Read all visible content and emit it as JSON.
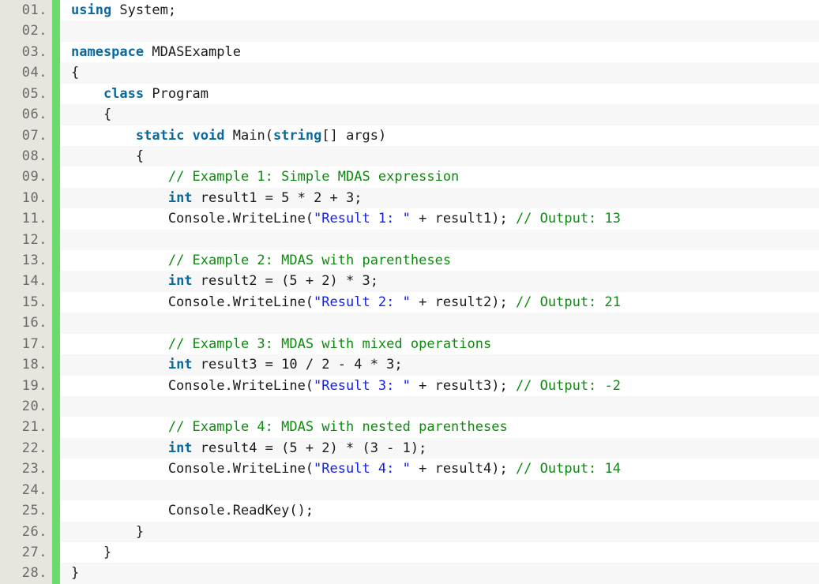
{
  "editor": {
    "language": "csharp",
    "total_lines": 28,
    "gutter_number_suffix": ".",
    "colors": {
      "gutter_background": "#e7e5dd",
      "gutter_text": "#6a6a6a",
      "marker_bar": "#6bdc6b",
      "row_odd_background": "#ffffff",
      "row_even_background": "#f7f7f7",
      "keyword": "#0b6a9d",
      "string": "#1420e8",
      "comment": "#0f8a10",
      "plain": "#1b1b1b"
    }
  },
  "lines": [
    {
      "number": "01.",
      "tokens": [
        {
          "t": "kw",
          "v": "using"
        },
        {
          "t": "pln",
          "v": " System;"
        }
      ]
    },
    {
      "number": "02.",
      "tokens": []
    },
    {
      "number": "03.",
      "tokens": [
        {
          "t": "kw",
          "v": "namespace"
        },
        {
          "t": "pln",
          "v": " MDASExample"
        }
      ]
    },
    {
      "number": "04.",
      "tokens": [
        {
          "t": "pln",
          "v": "{"
        }
      ]
    },
    {
      "number": "05.",
      "tokens": [
        {
          "t": "pln",
          "v": "    "
        },
        {
          "t": "kw",
          "v": "class"
        },
        {
          "t": "pln",
          "v": " Program"
        }
      ]
    },
    {
      "number": "06.",
      "tokens": [
        {
          "t": "pln",
          "v": "    {"
        }
      ]
    },
    {
      "number": "07.",
      "tokens": [
        {
          "t": "pln",
          "v": "        "
        },
        {
          "t": "kw",
          "v": "static"
        },
        {
          "t": "pln",
          "v": " "
        },
        {
          "t": "kw",
          "v": "void"
        },
        {
          "t": "pln",
          "v": " Main("
        },
        {
          "t": "kw",
          "v": "string"
        },
        {
          "t": "pln",
          "v": "[] args)"
        }
      ]
    },
    {
      "number": "08.",
      "tokens": [
        {
          "t": "pln",
          "v": "        {"
        }
      ]
    },
    {
      "number": "09.",
      "tokens": [
        {
          "t": "pln",
          "v": "            "
        },
        {
          "t": "com",
          "v": "// Example 1: Simple MDAS expression"
        }
      ]
    },
    {
      "number": "10.",
      "tokens": [
        {
          "t": "pln",
          "v": "            "
        },
        {
          "t": "kw",
          "v": "int"
        },
        {
          "t": "pln",
          "v": " result1 = 5 * 2 + 3;"
        }
      ]
    },
    {
      "number": "11.",
      "tokens": [
        {
          "t": "pln",
          "v": "            Console.WriteLine("
        },
        {
          "t": "str",
          "v": "\"Result 1: \""
        },
        {
          "t": "pln",
          "v": " + result1); "
        },
        {
          "t": "com",
          "v": "// Output: 13"
        }
      ]
    },
    {
      "number": "12.",
      "tokens": []
    },
    {
      "number": "13.",
      "tokens": [
        {
          "t": "pln",
          "v": "            "
        },
        {
          "t": "com",
          "v": "// Example 2: MDAS with parentheses"
        }
      ]
    },
    {
      "number": "14.",
      "tokens": [
        {
          "t": "pln",
          "v": "            "
        },
        {
          "t": "kw",
          "v": "int"
        },
        {
          "t": "pln",
          "v": " result2 = (5 + 2) * 3;"
        }
      ]
    },
    {
      "number": "15.",
      "tokens": [
        {
          "t": "pln",
          "v": "            Console.WriteLine("
        },
        {
          "t": "str",
          "v": "\"Result 2: \""
        },
        {
          "t": "pln",
          "v": " + result2); "
        },
        {
          "t": "com",
          "v": "// Output: 21"
        }
      ]
    },
    {
      "number": "16.",
      "tokens": []
    },
    {
      "number": "17.",
      "tokens": [
        {
          "t": "pln",
          "v": "            "
        },
        {
          "t": "com",
          "v": "// Example 3: MDAS with mixed operations"
        }
      ]
    },
    {
      "number": "18.",
      "tokens": [
        {
          "t": "pln",
          "v": "            "
        },
        {
          "t": "kw",
          "v": "int"
        },
        {
          "t": "pln",
          "v": " result3 = 10 / 2 - 4 * 3;"
        }
      ]
    },
    {
      "number": "19.",
      "tokens": [
        {
          "t": "pln",
          "v": "            Console.WriteLine("
        },
        {
          "t": "str",
          "v": "\"Result 3: \""
        },
        {
          "t": "pln",
          "v": " + result3); "
        },
        {
          "t": "com",
          "v": "// Output: -2"
        }
      ]
    },
    {
      "number": "20.",
      "tokens": []
    },
    {
      "number": "21.",
      "tokens": [
        {
          "t": "pln",
          "v": "            "
        },
        {
          "t": "com",
          "v": "// Example 4: MDAS with nested parentheses"
        }
      ]
    },
    {
      "number": "22.",
      "tokens": [
        {
          "t": "pln",
          "v": "            "
        },
        {
          "t": "kw",
          "v": "int"
        },
        {
          "t": "pln",
          "v": " result4 = (5 + 2) * (3 - 1);"
        }
      ]
    },
    {
      "number": "23.",
      "tokens": [
        {
          "t": "pln",
          "v": "            Console.WriteLine("
        },
        {
          "t": "str",
          "v": "\"Result 4: \""
        },
        {
          "t": "pln",
          "v": " + result4); "
        },
        {
          "t": "com",
          "v": "// Output: 14"
        }
      ]
    },
    {
      "number": "24.",
      "tokens": []
    },
    {
      "number": "25.",
      "tokens": [
        {
          "t": "pln",
          "v": "            Console.ReadKey();"
        }
      ]
    },
    {
      "number": "26.",
      "tokens": [
        {
          "t": "pln",
          "v": "        }"
        }
      ]
    },
    {
      "number": "27.",
      "tokens": [
        {
          "t": "pln",
          "v": "    }"
        }
      ]
    },
    {
      "number": "28.",
      "tokens": [
        {
          "t": "pln",
          "v": "}"
        }
      ]
    }
  ]
}
